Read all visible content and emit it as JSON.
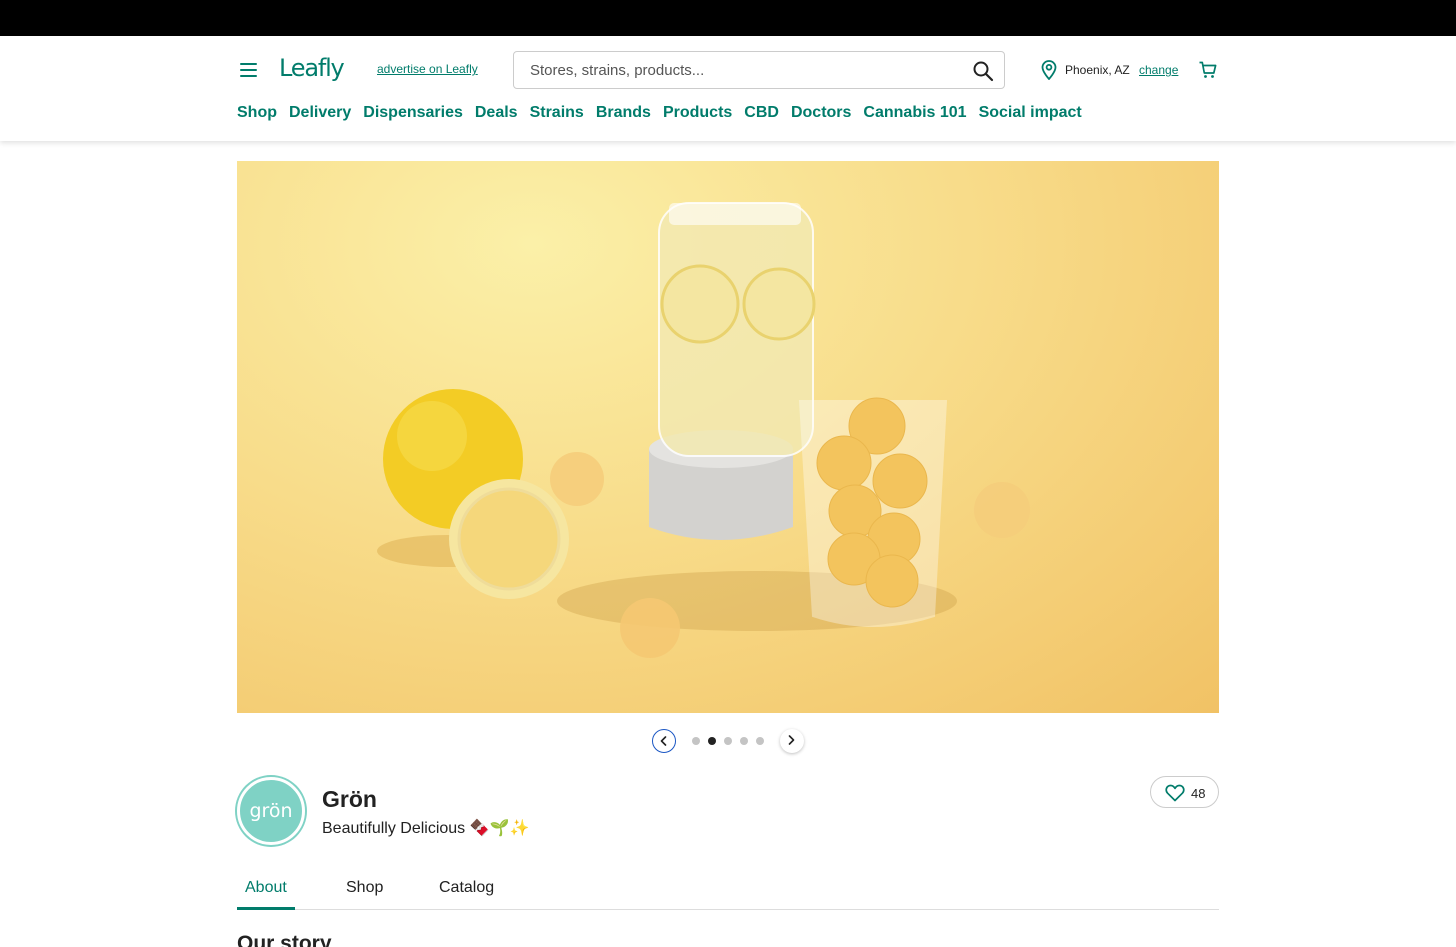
{
  "header": {
    "logo": "Leafly",
    "advertise_link": "advertise on Leafly",
    "search_placeholder": "Stores, strains, products...",
    "location": "Phoenix, AZ",
    "change_link": "change"
  },
  "nav": [
    "Shop",
    "Delivery",
    "Dispensaries",
    "Deals",
    "Strains",
    "Brands",
    "Products",
    "CBD",
    "Doctors",
    "Cannabis 101",
    "Social impact"
  ],
  "carousel": {
    "slide_count": 5,
    "active_index": 1
  },
  "brand": {
    "logo_text": "grön",
    "name": "Grön",
    "tagline": "Beautifully Delicious 🍫🌱✨",
    "favorites_count": "48"
  },
  "tabs": [
    {
      "label": "About",
      "active": true
    },
    {
      "label": "Shop",
      "active": false
    },
    {
      "label": "Catalog",
      "active": false
    }
  ],
  "section_heading": "Our story",
  "colors": {
    "brand_green": "#017c6b",
    "logo_teal": "#7fd2c5",
    "hero_yellow": "#f8dc8a"
  }
}
